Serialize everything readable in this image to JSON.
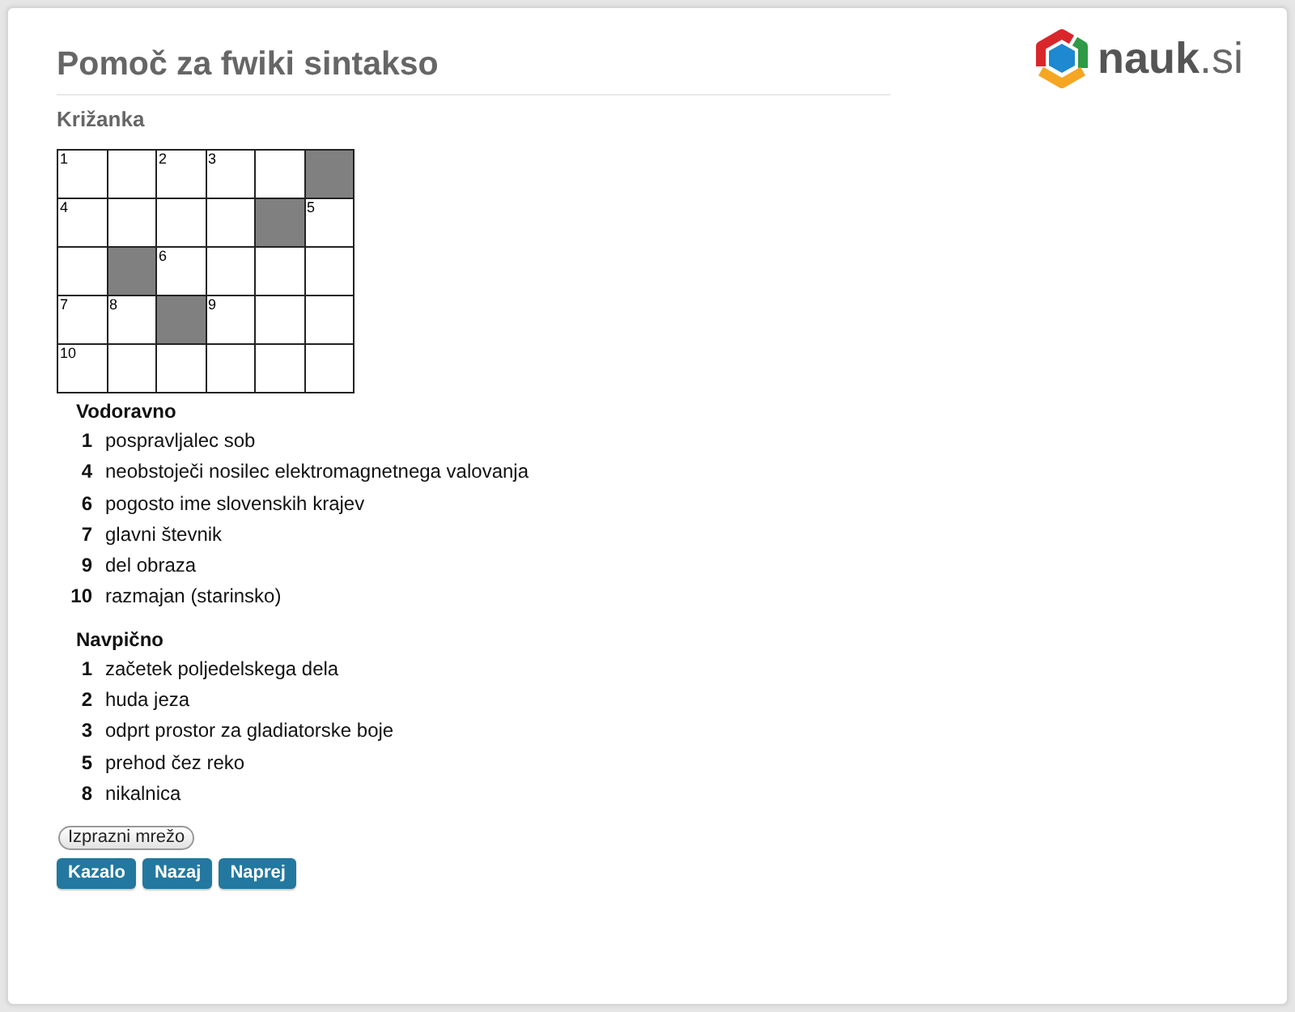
{
  "page": {
    "title": "Pomoč za fwiki sintakso"
  },
  "logo": {
    "text": "**nauk**.si"
  },
  "crossword": {
    "title": "Križanka",
    "grid": [
      [
        {
          "kind": "open",
          "number": "1"
        },
        {
          "kind": "open"
        },
        {
          "kind": "open",
          "number": "2"
        },
        {
          "kind": "open",
          "number": "3"
        },
        {
          "kind": "open"
        },
        {
          "kind": "block"
        }
      ],
      [
        {
          "kind": "open",
          "number": "4"
        },
        {
          "kind": "open"
        },
        {
          "kind": "open"
        },
        {
          "kind": "open"
        },
        {
          "kind": "block"
        },
        {
          "kind": "open",
          "number": "5"
        }
      ],
      [
        {
          "kind": "open"
        },
        {
          "kind": "block"
        },
        {
          "kind": "open",
          "number": "6"
        },
        {
          "kind": "open"
        },
        {
          "kind": "open"
        },
        {
          "kind": "open"
        }
      ],
      [
        {
          "kind": "open",
          "number": "7"
        },
        {
          "kind": "open",
          "number": "8"
        },
        {
          "kind": "block"
        },
        {
          "kind": "open",
          "number": "9"
        },
        {
          "kind": "open"
        },
        {
          "kind": "open"
        }
      ],
      [
        {
          "kind": "open",
          "number": "10"
        },
        {
          "kind": "open"
        },
        {
          "kind": "open"
        },
        {
          "kind": "open"
        },
        {
          "kind": "open"
        },
        {
          "kind": "open"
        }
      ]
    ]
  },
  "clue_groups": [
    {
      "title": "Vodoravno",
      "clues": [
        {
          "number": "1",
          "text": "pospravljalec sob"
        },
        {
          "number": "4",
          "text": "neobstoječi nosilec elektromagnetnega valovanja"
        },
        {
          "number": "6",
          "text": "pogosto ime slovenskih krajev"
        },
        {
          "number": "7",
          "text": "glavni števnik"
        },
        {
          "number": "9",
          "text": "del obraza"
        },
        {
          "number": "10",
          "text": "razmajan (starinsko)"
        }
      ]
    },
    {
      "title": "Navpično",
      "clues": [
        {
          "number": "1",
          "text": "začetek poljedelskega dela"
        },
        {
          "number": "2",
          "text": "huda jeza"
        },
        {
          "number": "3",
          "text": "odprt prostor za gladiatorske boje"
        },
        {
          "number": "5",
          "text": "prehod čez reko"
        },
        {
          "number": "8",
          "text": "nikalnica"
        }
      ]
    }
  ],
  "clear_button": "Izprazni mrežo",
  "nav_buttons": [
    "Kazalo",
    "Nazaj",
    "Naprej"
  ]
}
